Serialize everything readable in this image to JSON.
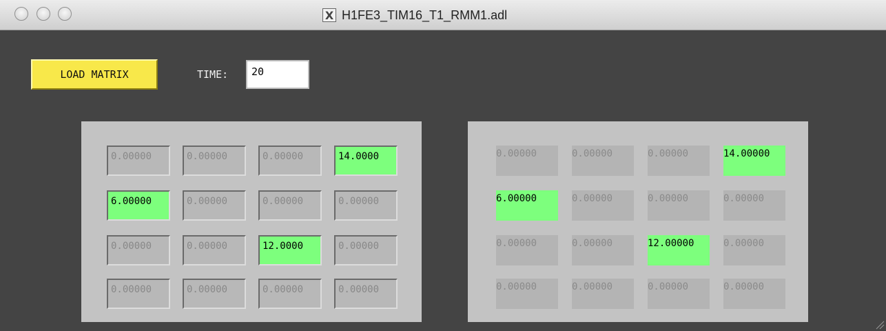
{
  "window": {
    "title": "H1FE3_TIM16_T1_RMM1.adl",
    "title_icon": "x11-icon"
  },
  "controls": {
    "load_label": "LOAD MATRIX",
    "time_label": "TIME:",
    "time_value": "20"
  },
  "colors": {
    "background": "#444444",
    "panel": "#c3c3c3",
    "highlight": "#7dff7d",
    "button": "#f8e84a"
  },
  "input_matrix": [
    [
      "0.00000",
      "0.00000",
      "0.00000",
      "14.0000"
    ],
    [
      "6.00000",
      "0.00000",
      "0.00000",
      "0.00000"
    ],
    [
      "0.00000",
      "0.00000",
      "12.0000",
      "0.00000"
    ],
    [
      "0.00000",
      "0.00000",
      "0.00000",
      "0.00000"
    ]
  ],
  "output_matrix": [
    [
      "0.00000",
      "0.00000",
      "0.00000",
      "14.00000"
    ],
    [
      "6.00000",
      "0.00000",
      "0.00000",
      "0.00000"
    ],
    [
      "0.00000",
      "0.00000",
      "12.00000",
      "0.00000"
    ],
    [
      "0.00000",
      "0.00000",
      "0.00000",
      "0.00000"
    ]
  ]
}
